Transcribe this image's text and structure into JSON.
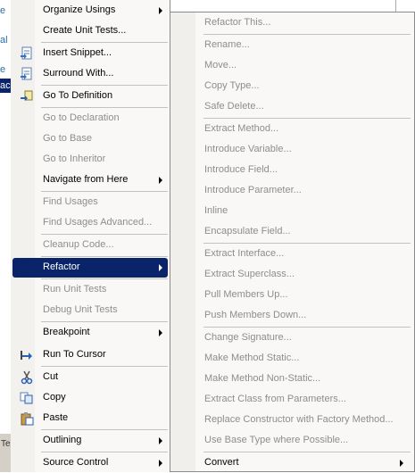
{
  "background": {
    "editor_fragments": [
      "e",
      "al",
      "",
      "e",
      "ac"
    ],
    "status_fragment": "Te"
  },
  "main_menu": {
    "items": [
      {
        "label": "Organize Usings",
        "enabled": true,
        "submenu": true
      },
      {
        "label": "Create Unit Tests...",
        "enabled": true,
        "submenu": false
      },
      {
        "label": "Insert Snippet...",
        "enabled": true,
        "submenu": false,
        "icon": "snippet-icon"
      },
      {
        "label": "Surround With...",
        "enabled": true,
        "submenu": false,
        "icon": "surround-icon"
      },
      {
        "label": "Go To Definition",
        "enabled": true,
        "submenu": false,
        "icon": "goto-definition-icon"
      },
      {
        "label": "Go to Declaration",
        "enabled": false,
        "submenu": false
      },
      {
        "label": "Go to Base",
        "enabled": false,
        "submenu": false
      },
      {
        "label": "Go to Inheritor",
        "enabled": false,
        "submenu": false
      },
      {
        "label": "Navigate from Here",
        "enabled": true,
        "submenu": true
      },
      {
        "label": "Find Usages",
        "enabled": false,
        "submenu": false
      },
      {
        "label": "Find Usages Advanced...",
        "enabled": false,
        "submenu": false
      },
      {
        "label": "Cleanup Code...",
        "enabled": false,
        "submenu": false
      },
      {
        "label": "Refactor",
        "enabled": true,
        "submenu": true,
        "selected": true
      },
      {
        "label": "Run Unit Tests",
        "enabled": false,
        "submenu": false
      },
      {
        "label": "Debug Unit Tests",
        "enabled": false,
        "submenu": false
      },
      {
        "label": "Breakpoint",
        "enabled": true,
        "submenu": true
      },
      {
        "label": "Run To Cursor",
        "enabled": true,
        "submenu": false,
        "icon": "run-to-cursor-icon"
      },
      {
        "label": "Cut",
        "enabled": true,
        "submenu": false,
        "icon": "scissors-icon"
      },
      {
        "label": "Copy",
        "enabled": true,
        "submenu": false,
        "icon": "copy-icon"
      },
      {
        "label": "Paste",
        "enabled": true,
        "submenu": false,
        "icon": "paste-icon"
      },
      {
        "label": "Outlining",
        "enabled": true,
        "submenu": true
      },
      {
        "label": "Source Control",
        "enabled": true,
        "submenu": true
      }
    ]
  },
  "refactor_menu": {
    "items": [
      {
        "label": "Refactor This...",
        "enabled": false
      },
      {
        "label": "Rename...",
        "enabled": false
      },
      {
        "label": "Move...",
        "enabled": false
      },
      {
        "label": "Copy Type...",
        "enabled": false
      },
      {
        "label": "Safe Delete...",
        "enabled": false
      },
      {
        "label": "Extract Method...",
        "enabled": false
      },
      {
        "label": "Introduce Variable...",
        "enabled": false
      },
      {
        "label": "Introduce Field...",
        "enabled": false
      },
      {
        "label": "Introduce Parameter...",
        "enabled": false
      },
      {
        "label": "Inline",
        "enabled": false
      },
      {
        "label": "Encapsulate Field...",
        "enabled": false
      },
      {
        "label": "Extract Interface...",
        "enabled": false
      },
      {
        "label": "Extract Superclass...",
        "enabled": false
      },
      {
        "label": "Pull Members Up...",
        "enabled": false
      },
      {
        "label": "Push Members Down...",
        "enabled": false
      },
      {
        "label": "Change Signature...",
        "enabled": false
      },
      {
        "label": "Make Method Static...",
        "enabled": false
      },
      {
        "label": "Make Method Non-Static...",
        "enabled": false
      },
      {
        "label": "Extract Class from Parameters...",
        "enabled": false
      },
      {
        "label": "Replace Constructor with Factory Method...",
        "enabled": false
      },
      {
        "label": "Use Base Type where Possible...",
        "enabled": false
      },
      {
        "label": "Convert",
        "enabled": true,
        "submenu": true
      }
    ]
  },
  "colors": {
    "selection": "#0a246a",
    "disabled_text": "#8d8d8d",
    "menu_bg": "#f9f8f7"
  }
}
